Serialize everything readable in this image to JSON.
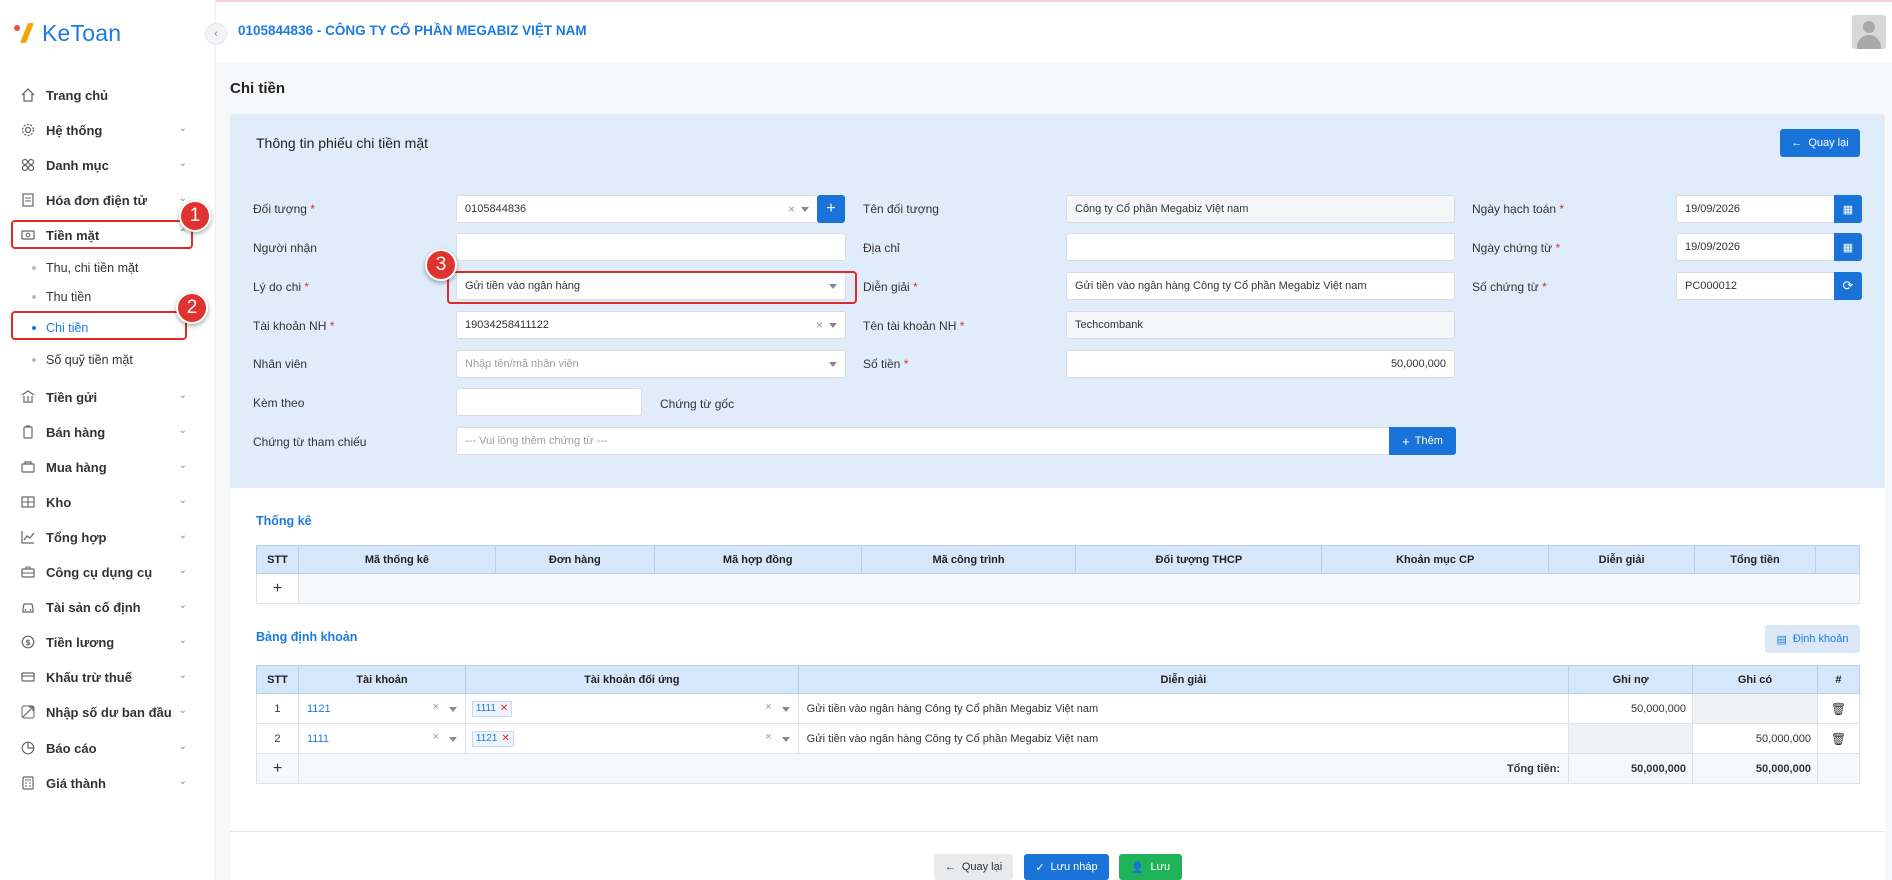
{
  "app": {
    "logo": "KeToan",
    "company": "0105844836 - CÔNG TY CỔ PHẦN MEGABIZ VIỆT NAM"
  },
  "sidebar": {
    "items": [
      {
        "label": "Trang chủ",
        "icon": "home-icon"
      },
      {
        "label": "Hệ thống",
        "icon": "gear-icon"
      },
      {
        "label": "Danh mục",
        "icon": "grid-icon"
      },
      {
        "label": "Hóa đơn điện tử",
        "icon": "invoice-icon"
      },
      {
        "label": "Tiền mặt",
        "icon": "cash-icon"
      },
      {
        "label": "Tiền gửi",
        "icon": "bank-icon"
      },
      {
        "label": "Bán hàng",
        "icon": "sales-icon"
      },
      {
        "label": "Mua hàng",
        "icon": "cart-icon"
      },
      {
        "label": "Kho",
        "icon": "warehouse-icon"
      },
      {
        "label": "Tổng hợp",
        "icon": "chart-icon"
      },
      {
        "label": "Công cụ dụng cụ",
        "icon": "tools-icon"
      },
      {
        "label": "Tài sản cố định",
        "icon": "car-icon"
      },
      {
        "label": "Tiền lương",
        "icon": "salary-icon"
      },
      {
        "label": "Khấu trừ thuế",
        "icon": "tax-icon"
      },
      {
        "label": "Nhập số dư ban đầu",
        "icon": "balance-icon"
      },
      {
        "label": "Báo cáo",
        "icon": "report-icon"
      },
      {
        "label": "Giá thành",
        "icon": "cost-icon"
      }
    ],
    "sub_items": [
      "Thu, chi tiền mặt",
      "Thu tiền",
      "Chi tiền",
      "Số quỹ tiền mặt"
    ],
    "badges": [
      "1",
      "2",
      "3"
    ]
  },
  "page": {
    "title": "Chi tiền",
    "card_title": "Thông tin phiếu chi tiền mặt",
    "back_label": "Quay lại"
  },
  "form": {
    "doi_tuong": {
      "label": "Đối tượng",
      "value": "0105844836"
    },
    "ten_doi_tuong": {
      "label": "Tên đối tượng",
      "value": "Công ty Cổ phần Megabiz Việt nam"
    },
    "ngay_hach_toan": {
      "label": "Ngày hạch toán",
      "value": "19/09/2026"
    },
    "nguoi_nhan": {
      "label": "Người nhận",
      "value": ""
    },
    "dia_chi": {
      "label": "Địa chỉ",
      "value": ""
    },
    "ngay_chung_tu": {
      "label": "Ngày chứng từ",
      "value": "19/09/2026"
    },
    "ly_do_chi": {
      "label": "Lý do chi",
      "value": "Gửi tiền vào ngân hàng"
    },
    "dien_giai": {
      "label": "Diễn giải",
      "value": "Gửi tiền vào ngân hàng Công ty Cổ phần Megabiz Việt nam"
    },
    "so_chung_tu": {
      "label": "Số chứng từ",
      "value": "PC000012"
    },
    "tai_khoan_nh": {
      "label": "Tài khoản NH",
      "value": "19034258411122"
    },
    "ten_tai_khoan_nh": {
      "label": "Tên tài khoản NH",
      "value": "Techcombank"
    },
    "nhan_vien": {
      "label": "Nhân viên",
      "placeholder": "Nhập tên/mã nhân viên"
    },
    "so_tien": {
      "label": "Số tiền",
      "value": "50,000,000"
    },
    "kem_theo": {
      "label": "Kèm theo",
      "value": "",
      "suffix": "Chứng từ gốc"
    },
    "chung_tu_tham_chieu": {
      "label": "Chứng từ tham chiếu",
      "placeholder": "--- Vui lòng thêm chứng từ ---",
      "add_label": "Thêm"
    }
  },
  "thong_ke": {
    "title": "Thống kê",
    "headers": [
      "STT",
      "Mã thống kê",
      "Đơn hàng",
      "Mã hợp đồng",
      "Mã công trình",
      "Đối tượng THCP",
      "Khoản mục CP",
      "Diễn giải",
      "Tổng tiền",
      ""
    ]
  },
  "dinh_khoan": {
    "title": "Bảng định khoản",
    "button_label": "Định khoản",
    "headers": [
      "STT",
      "Tài khoản",
      "Tài khoản đối ứng",
      "Diễn giải",
      "Ghi nợ",
      "Ghi có",
      "#"
    ],
    "rows": [
      {
        "stt": "1",
        "tai_khoan": "1121",
        "doi_ung": "1111",
        "dien_giai": "Gửi tiền vào ngân hàng Công ty Cổ phần Megabiz Việt nam",
        "ghi_no": "50,000,000",
        "ghi_co": ""
      },
      {
        "stt": "2",
        "tai_khoan": "1111",
        "doi_ung": "1121",
        "dien_giai": "Gửi tiền vào ngân hàng Công ty Cổ phần Megabiz Việt nam",
        "ghi_no": "",
        "ghi_co": "50,000,000"
      }
    ],
    "total_label": "Tổng tiền:",
    "total_no": "50,000,000",
    "total_co": "50,000,000"
  },
  "footer": {
    "back": "Quay lại",
    "draft": "Lưu nháp",
    "save": "Lưu"
  },
  "colors": {
    "primary": "#1a73d9",
    "success": "#21b35a",
    "danger": "#e02b2b",
    "header_bg": "#e1ecfa"
  }
}
